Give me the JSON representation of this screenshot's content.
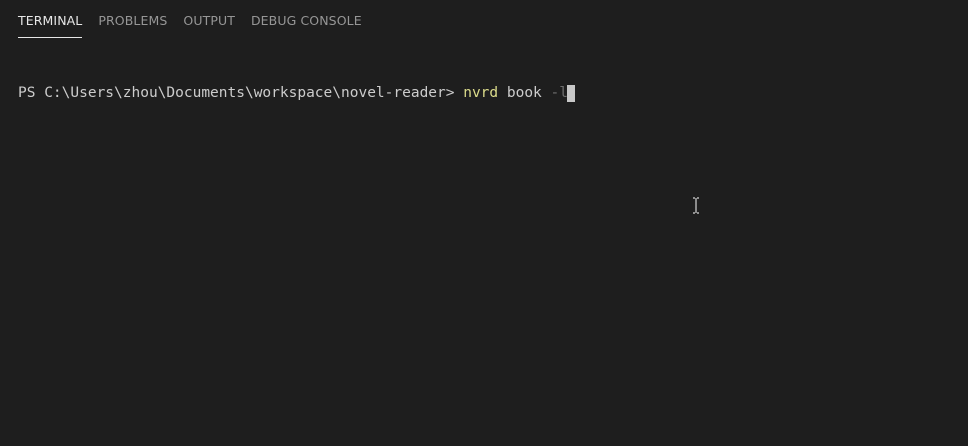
{
  "tabs": [
    {
      "label": "TERMINAL",
      "active": true
    },
    {
      "label": "PROBLEMS",
      "active": false
    },
    {
      "label": "OUTPUT",
      "active": false
    },
    {
      "label": "DEBUG CONSOLE",
      "active": false
    }
  ],
  "terminal": {
    "prompt": "PS C:\\Users\\zhou\\Documents\\workspace\\novel-reader> ",
    "command": "nvrd",
    "argument": " book ",
    "flag": "-l"
  },
  "colors": {
    "background": "#1e1e1e",
    "tab_active": "#e7e7e7",
    "tab_inactive": "#969696",
    "command": "#dcdc8b",
    "text": "#cccccc"
  },
  "icons": {
    "mouse_cursor": "text-ibeam-cursor-icon"
  }
}
